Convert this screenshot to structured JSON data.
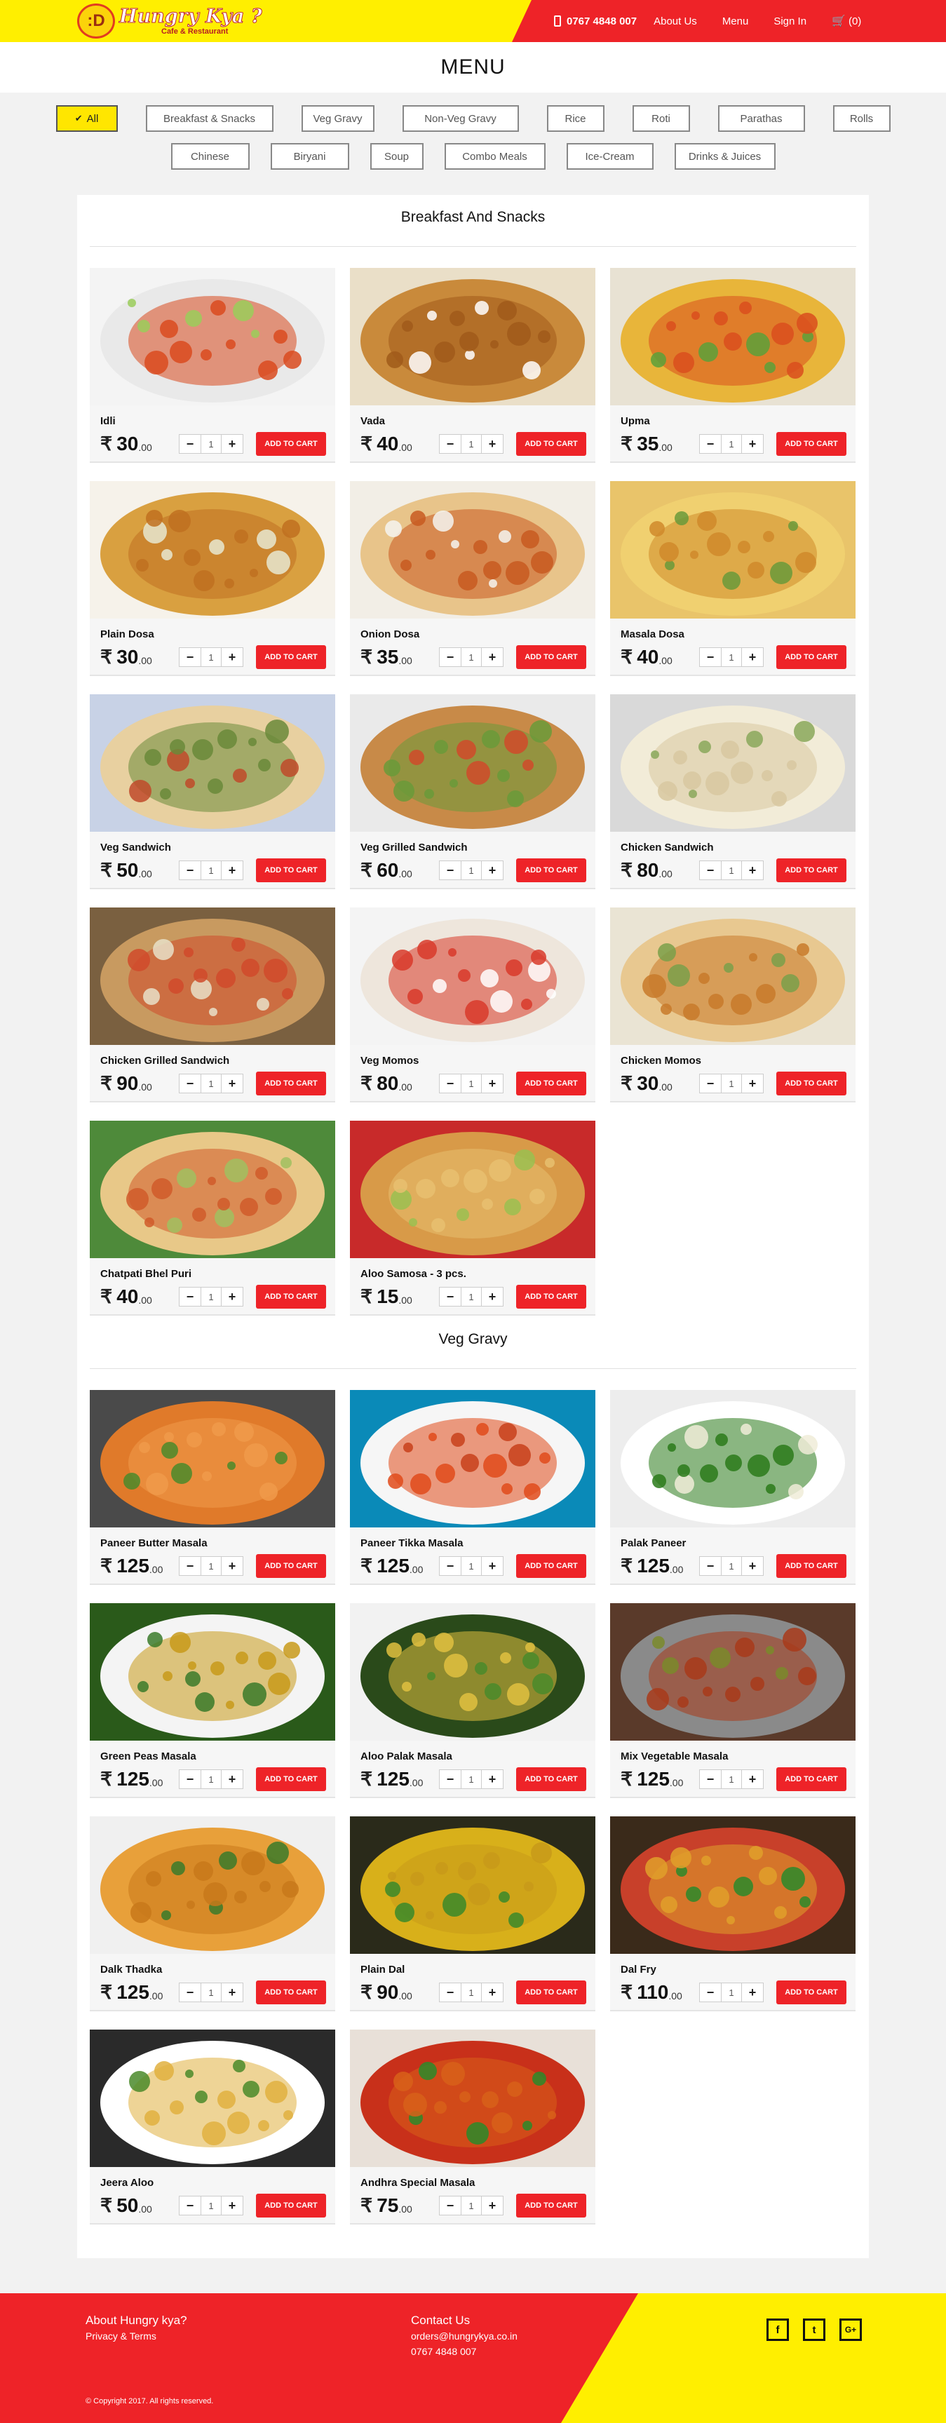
{
  "header": {
    "brand": "Hungry Kya ?",
    "brand_sub": "Cafe & Restaurant",
    "logo_face": ":D",
    "phone": "0767 4848 007",
    "nav": [
      "About Us",
      "Menu",
      "Sign In"
    ],
    "cart_label": "(0)",
    "colors": {
      "yellow": "#ffef00",
      "red": "#ee2328"
    }
  },
  "page_title": "MENU",
  "filters": {
    "row1": [
      "All",
      "Breakfast & Snacks",
      "Veg Gravy",
      "Non-Veg Gravy",
      "Rice",
      "Roti",
      "Parathas",
      "Rolls"
    ],
    "row2": [
      "Chinese",
      "Biryani",
      "Soup",
      "Combo Meals",
      "Ice-Cream",
      "Drinks & Juices"
    ],
    "active": "All",
    "check_glyph": "✔"
  },
  "currency": "₹",
  "add_label": "ADD TO CART",
  "qty": {
    "minus": "−",
    "value": "1",
    "plus": "+"
  },
  "sections": [
    {
      "title": "Breakfast And Snacks",
      "items": [
        {
          "name": "Idli",
          "price": "30",
          "dec": ".00"
        },
        {
          "name": "Vada",
          "price": "40",
          "dec": ".00"
        },
        {
          "name": "Upma",
          "price": "35",
          "dec": ".00"
        },
        {
          "name": "Plain Dosa",
          "price": "30",
          "dec": ".00"
        },
        {
          "name": "Onion Dosa",
          "price": "35",
          "dec": ".00"
        },
        {
          "name": "Masala Dosa",
          "price": "40",
          "dec": ".00"
        },
        {
          "name": "Veg Sandwich",
          "price": "50",
          "dec": ".00"
        },
        {
          "name": "Veg Grilled Sandwich",
          "price": "60",
          "dec": ".00"
        },
        {
          "name": "Chicken Sandwich",
          "price": "80",
          "dec": ".00"
        },
        {
          "name": "Chicken Grilled Sandwich",
          "price": "90",
          "dec": ".00"
        },
        {
          "name": "Veg Momos",
          "price": "80",
          "dec": ".00"
        },
        {
          "name": "Chicken Momos",
          "price": "30",
          "dec": ".00"
        },
        {
          "name": "Chatpati Bhel Puri",
          "price": "40",
          "dec": ".00"
        },
        {
          "name": "Aloo Samosa - 3 pcs.",
          "price": "15",
          "dec": ".00"
        }
      ]
    },
    {
      "title": "Veg Gravy",
      "items": [
        {
          "name": "Paneer Butter Masala",
          "price": "125",
          "dec": ".00"
        },
        {
          "name": "Paneer Tikka Masala",
          "price": "125",
          "dec": ".00"
        },
        {
          "name": "Palak Paneer",
          "price": "125",
          "dec": ".00"
        },
        {
          "name": "Green Peas Masala",
          "price": "125",
          "dec": ".00"
        },
        {
          "name": "Aloo Palak Masala",
          "price": "125",
          "dec": ".00"
        },
        {
          "name": "Mix Vegetable Masala",
          "price": "125",
          "dec": ".00"
        },
        {
          "name": "Dalk Thadka",
          "price": "125",
          "dec": ".00"
        },
        {
          "name": "Plain Dal",
          "price": "90",
          "dec": ".00"
        },
        {
          "name": "Dal Fry",
          "price": "110",
          "dec": ".00"
        },
        {
          "name": "Jeera Aloo",
          "price": "50",
          "dec": ".00"
        },
        {
          "name": "Andhra Special Masala",
          "price": "75",
          "dec": ".00"
        }
      ]
    }
  ],
  "footer": {
    "about": "About Hungry kya?",
    "privacy": "Privacy & Terms",
    "contact": "Contact Us",
    "email": "orders@hungrykya.co.in",
    "phone": "0767 4848 007",
    "copyright": "© Copyright 2017. All rights reserved.",
    "social": [
      "f",
      "t",
      "G+"
    ]
  }
}
